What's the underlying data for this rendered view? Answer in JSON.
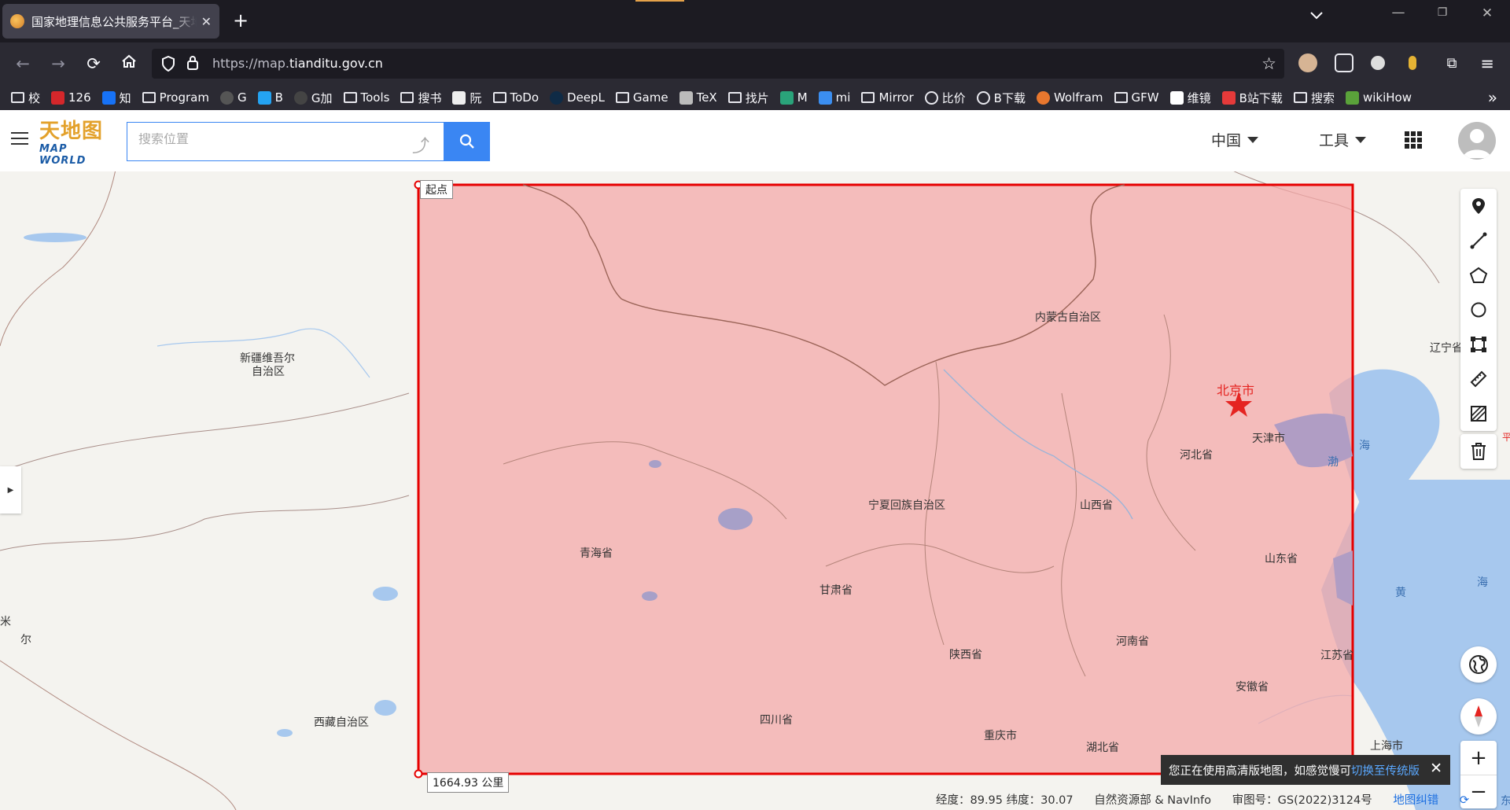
{
  "browser": {
    "tab_title": "国家地理信息公共服务平台_天地图",
    "url_prefix": "https://map.",
    "url_domain": "tianditu.gov.cn",
    "bookmarks": [
      "校",
      "126",
      "知",
      "Program",
      "G",
      "B",
      "G加",
      "Tools",
      "搜书",
      "阮",
      "ToDo",
      "DeepL",
      "Game",
      "TeX",
      "找片",
      "M",
      "mi",
      "Mirror",
      "比价",
      "B下载",
      "Wolfram",
      "GFW",
      "维镜",
      "B站下载",
      "搜索",
      "wikiHow"
    ]
  },
  "site": {
    "logo_cn": "天地图",
    "logo_en": "MAP WORLD",
    "search_placeholder": "搜索位置",
    "region": "中国",
    "tools": "工具"
  },
  "map": {
    "labels": {
      "xinjiang_1": "新疆维吾尔",
      "xinjiang_2": "自治区",
      "neimenggu": "内蒙古自治区",
      "beijing": "北京市",
      "tianjin": "天津市",
      "hebei": "河北省",
      "liaoning": "辽宁省",
      "ningxia": "宁夏回族自治区",
      "shanxi": "山西省",
      "qinghai": "青海省",
      "gansu": "甘肃省",
      "shandong": "山东省",
      "henan": "河南省",
      "shaanxi": "陕西省",
      "jiangsu": "江苏省",
      "anhui": "安徽省",
      "sichuan": "四川省",
      "chongqing": "重庆市",
      "hubei": "湖北省",
      "xizang": "西藏自治区",
      "shanghai": "上海市",
      "bohai": "渤",
      "sea_a": "海",
      "sea_b": "海",
      "huang": "黄",
      "ping": "平",
      "mi": "米",
      "er": "尔",
      "dong": "东"
    },
    "start_label": "起点",
    "distance_label": "1664.93 公里",
    "notice_text": "您正在使用高清版地图，如感觉慢可",
    "notice_link": "切换至传统版",
    "status": {
      "coords": "经度：89.95  纬度：30.07",
      "provider": "自然资源部 & NavInfo",
      "approval": "审图号：GS(2022)3124号",
      "report_link": "地图纠错"
    }
  },
  "colors": {
    "accent": "#3a86f3",
    "measure_stroke": "#e60000",
    "measure_fill": "#f4a6a6",
    "capital": "#e52421",
    "water": "#a7c8ee"
  }
}
